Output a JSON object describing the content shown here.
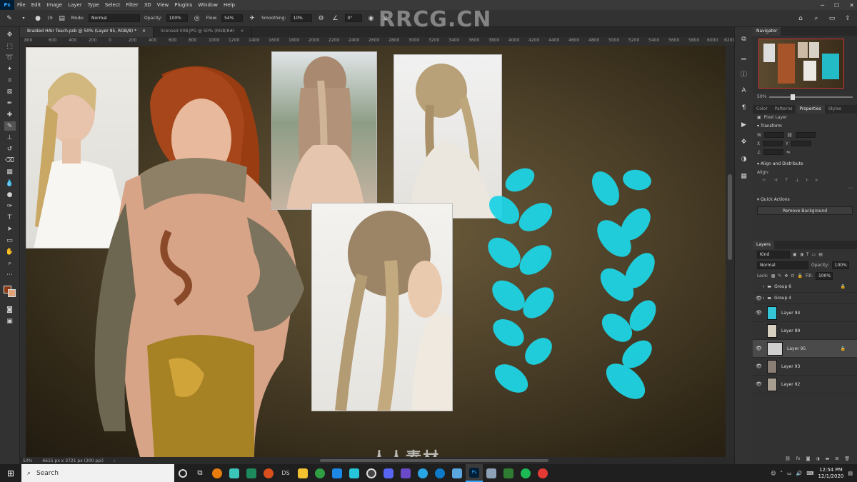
{
  "menubar": {
    "app_icon": "Ps",
    "items": [
      "File",
      "Edit",
      "Image",
      "Layer",
      "Type",
      "Select",
      "Filter",
      "3D",
      "View",
      "Plugins",
      "Window",
      "Help"
    ],
    "window_controls": [
      "minimize-icon",
      "maximize-icon",
      "close-icon"
    ]
  },
  "options": {
    "brush_size": "19",
    "mode_label": "Mode:",
    "mode_value": "Normal",
    "opacity_label": "Opacity:",
    "opacity_value": "100%",
    "flow_label": "Flow:",
    "flow_value": "54%",
    "smoothing_label": "Smoothing:",
    "smoothing_value": "10%",
    "angle_value": "0°"
  },
  "watermark_top": "RRCG.CN",
  "doc_tabs": [
    {
      "label": "Braided HAir Teach.psb @ 50% (Layer 95, RGB/8) *",
      "active": true
    },
    {
      "label": "licensed 008.JPG @ 50% (RGB/8#)",
      "active": false
    }
  ],
  "ruler": [
    "800",
    "600",
    "400",
    "200",
    "0",
    "200",
    "400",
    "600",
    "800",
    "1000",
    "1200",
    "1400",
    "1600",
    "1800",
    "2000",
    "2200",
    "2400",
    "2600",
    "2800",
    "3000",
    "3200",
    "3400",
    "3600",
    "3800",
    "4000",
    "4200",
    "4400",
    "4600",
    "4800",
    "5000",
    "5200",
    "5400",
    "5600",
    "5800",
    "6000",
    "6200"
  ],
  "status": {
    "zoom": "50%",
    "doc_info": "6615 px x 3721 px (300 ppi)"
  },
  "navigator": {
    "title": "Navigator",
    "zoom": "50%"
  },
  "properties": {
    "tabs": [
      "Color",
      "Patterns",
      "Properties",
      "Styles"
    ],
    "active_tab": "Properties",
    "layer_kind": "Pixel Layer",
    "transform_title": "Transform",
    "align_title": "Align and Distribute",
    "align_label": "Align:",
    "quick_actions_title": "Quick Actions",
    "remove_bg_label": "Remove Background"
  },
  "layers": {
    "title": "Layers",
    "kind_filter": "Kind",
    "blend_mode": "Normal",
    "opacity_label": "Opacity:",
    "opacity_value": "100%",
    "lock_label": "Lock:",
    "fill_label": "Fill:",
    "fill_value": "100%",
    "items": [
      {
        "name": "Group 6",
        "type": "group",
        "visible": false,
        "selected": false
      },
      {
        "name": "Group 4",
        "type": "group",
        "visible": true,
        "selected": false
      },
      {
        "name": "Layer 94",
        "type": "layer",
        "visible": true,
        "selected": false,
        "thumb": "#35c5d6"
      },
      {
        "name": "Layer 89",
        "type": "layer",
        "visible": false,
        "selected": false,
        "thumb": "#d7d0c0"
      },
      {
        "name": "Layer 95",
        "type": "layer",
        "visible": true,
        "selected": true,
        "thumb": "#cfcfcf"
      },
      {
        "name": "Layer 93",
        "type": "layer",
        "visible": true,
        "selected": false,
        "thumb": "#8a7f74"
      },
      {
        "name": "Layer 92",
        "type": "layer",
        "visible": true,
        "selected": false,
        "thumb": "#a89e92"
      }
    ]
  },
  "taskbar": {
    "search_placeholder": "Search",
    "time": "12:54 PM",
    "date": "12/1/2020"
  },
  "watermark_bottom": "人人素材",
  "colors": {
    "accent_cyan": "#1ed4e4",
    "canvas_bg": "#4b3f28",
    "foreground_swatch": "#8a3a12",
    "background_swatch": "#e0a27a"
  }
}
